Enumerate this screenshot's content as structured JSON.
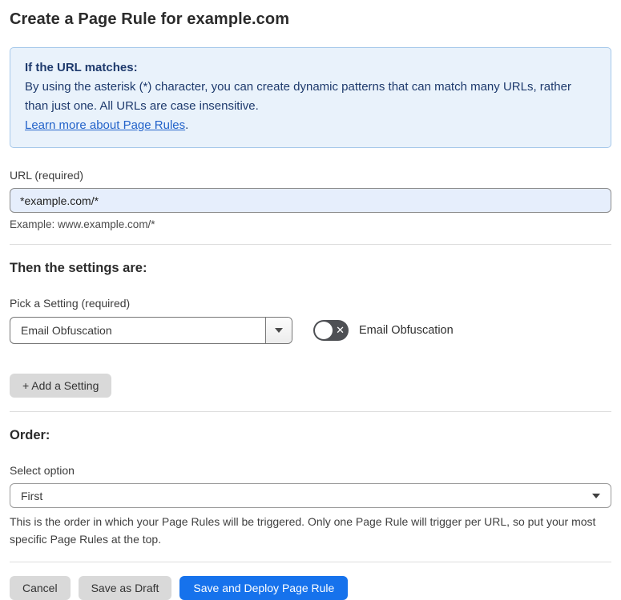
{
  "page": {
    "title": "Create a Page Rule for example.com"
  },
  "info_box": {
    "heading": "If the URL matches:",
    "body": "By using the asterisk (*) character, you can create dynamic patterns that can match many URLs, rather than just one. All URLs are case insensitive.",
    "link": "Learn more about Page Rules",
    "link_suffix": "."
  },
  "url_field": {
    "label": "URL (required)",
    "value": "*example.com/*",
    "helper": "Example: www.example.com/*"
  },
  "settings_section": {
    "heading": "Then the settings are:",
    "pick_label": "Pick a Setting (required)",
    "selected_setting": "Email Obfuscation",
    "toggle_label": "Email Obfuscation",
    "toggle_state": "off",
    "toggle_x_glyph": "✕",
    "add_button": "+ Add a Setting"
  },
  "order_section": {
    "heading": "Order:",
    "select_label": "Select option",
    "selected_option": "First",
    "helper": "This is the order in which your Page Rules will be triggered. Only one Page Rule will trigger per URL, so put your most specific Page Rules at the top."
  },
  "footer": {
    "cancel": "Cancel",
    "save_draft": "Save as Draft",
    "save_deploy": "Save and Deploy Page Rule"
  },
  "colors": {
    "accent_blue": "#1672ec",
    "info_bg": "#e9f2fb",
    "info_border": "#a6c8ea",
    "info_text": "#1e3a6d",
    "link_blue": "#2262c9",
    "url_input_bg": "#e6eefc",
    "toggle_off_bg": "#4e5054",
    "grey_button_bg": "#d9d9d9"
  }
}
